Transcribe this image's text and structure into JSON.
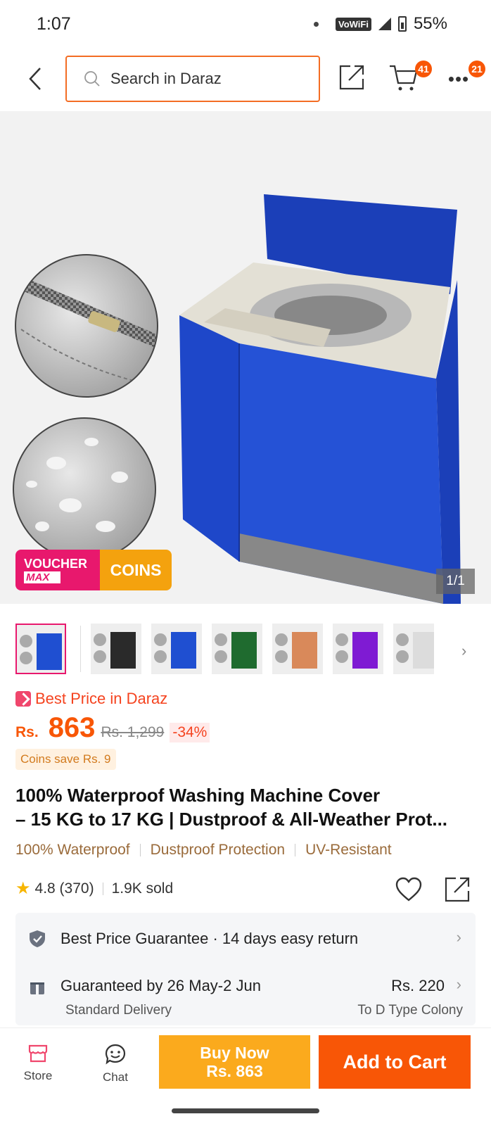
{
  "status_bar": {
    "time": "1:07",
    "network": "VoWiFi",
    "battery": "55%"
  },
  "header": {
    "search_placeholder": "Search in Daraz",
    "cart_count": "41",
    "more_count": "21",
    "icons": [
      "back-arrow-icon",
      "search-icon",
      "share-icon",
      "cart-icon",
      "more-icon"
    ]
  },
  "gallery": {
    "voucher_title": "VOUCHER",
    "voucher_sub": "MAX",
    "coins_label": "COINS",
    "counter": "1/1",
    "thumbnails": [
      {
        "color": "#1f4fd1",
        "active": true
      },
      {
        "color": "#2a2a2a",
        "active": false
      },
      {
        "color": "#1f4fd1",
        "active": false
      },
      {
        "color": "#1f6b2f",
        "active": false
      },
      {
        "color": "#d9895a",
        "active": false
      },
      {
        "color": "#7f1bd3",
        "active": false
      },
      {
        "color": "#dcdcdc",
        "active": false
      }
    ]
  },
  "price": {
    "best_price_label": "Best Price in Daraz",
    "currency": "Rs.",
    "current": "863",
    "original": "Rs. 1,299",
    "discount": "-34%",
    "coins_save": "Coins save Rs. 9"
  },
  "product": {
    "title_line1": "100% Waterproof Washing Machine Cover",
    "title_line2": "– 15 KG to 17 KG | Dustproof & All-Weather Prot...",
    "tags": [
      "100% Waterproof",
      "Dustproof Protection",
      "UV-Resistant"
    ],
    "rating": "4.8 (370)",
    "sold": "1.9K sold"
  },
  "services": {
    "guarantee": "Best Price Guarantee",
    "return_policy": "14 days easy return",
    "delivery_text": "Guaranteed by 26 May-2 Jun",
    "delivery_price": "Rs. 220",
    "delivery_type": "Standard Delivery",
    "delivery_location": "To D Type Colony"
  },
  "bottom_bar": {
    "store_label": "Store",
    "chat_label": "Chat",
    "buy_now_line1": "Buy Now",
    "buy_now_line2": "Rs. 863",
    "add_to_cart": "Add to Cart"
  },
  "colors": {
    "brand_orange": "#f85606",
    "buy_now": "#fbaa1d",
    "search_border": "#f36d24",
    "voucher_pink": "#e8186d",
    "coins_gold": "#f4a20e"
  }
}
